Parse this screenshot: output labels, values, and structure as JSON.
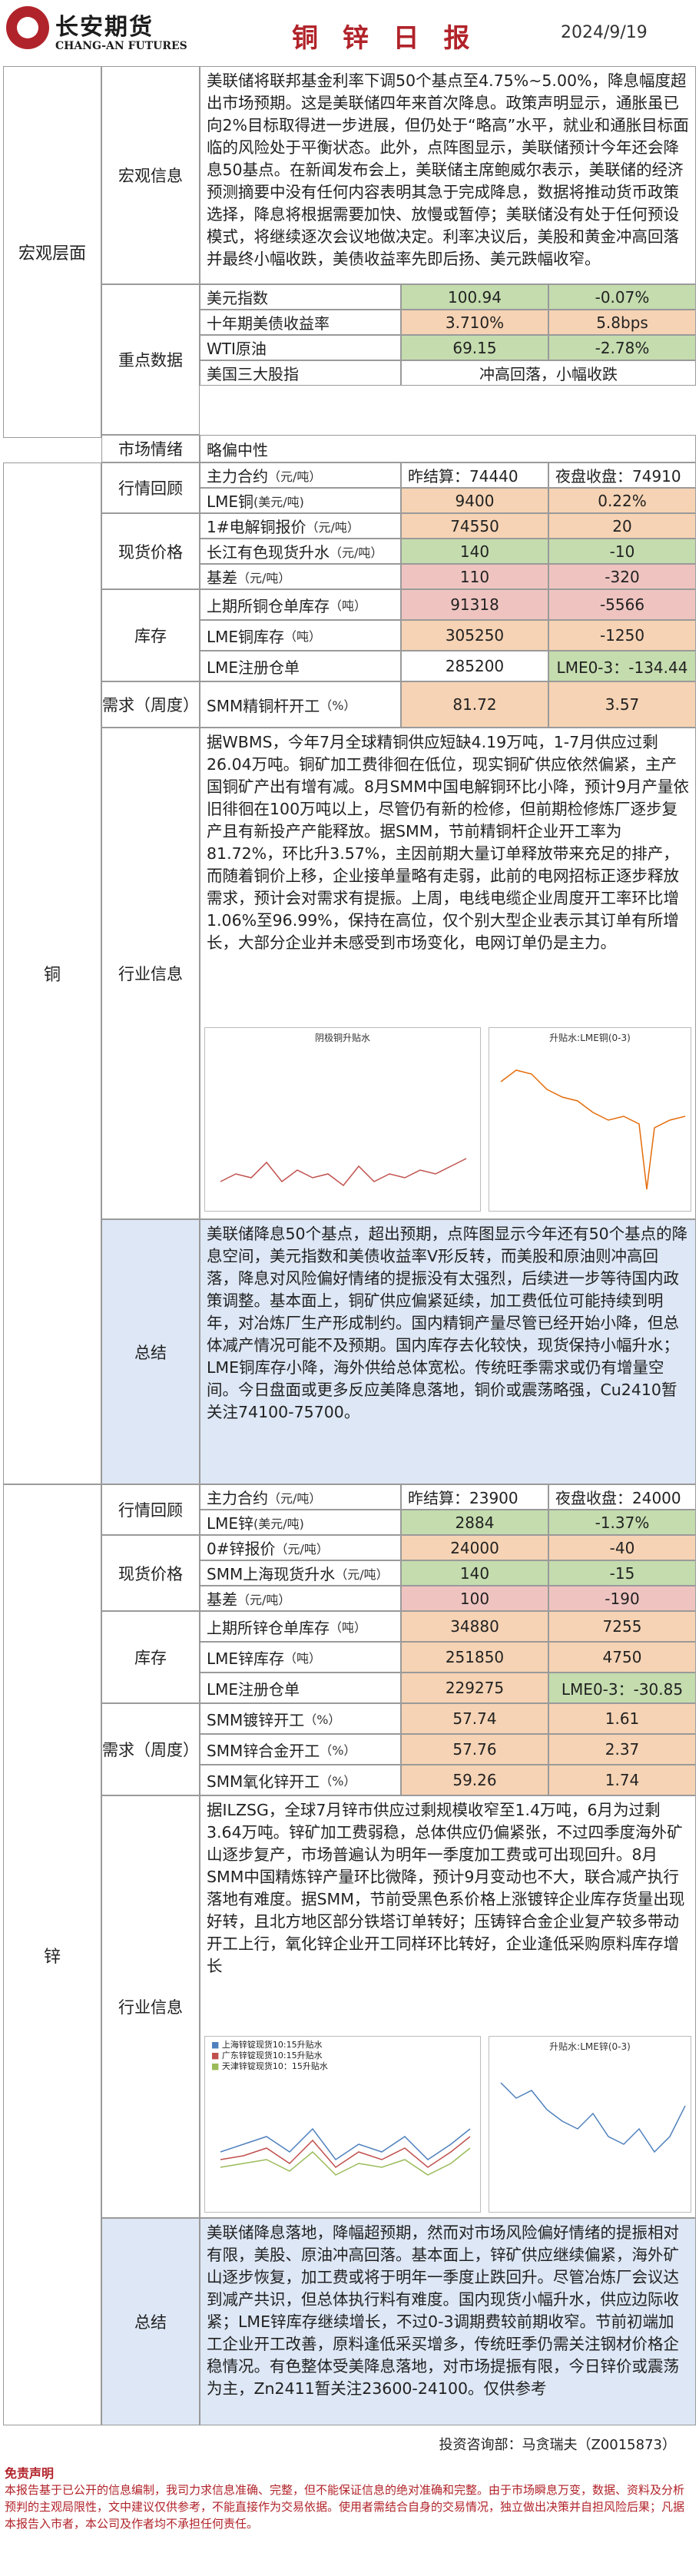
{
  "header": {
    "logo_cn": "长安期货",
    "logo_en": "CHANG-AN FUTURES",
    "title": "铜 锌 日 报",
    "date": "2024/9/19",
    "brand_color": "#b1232a"
  },
  "macro": {
    "section": "宏观层面",
    "info_label": "宏观信息",
    "info_text": "美联储将联邦基金利率下调50个基点至4.75%~5.00%，降息幅度超出市场预期。这是美联储四年来首次降息。政策声明显示，通胀虽已向2%目标取得进一步进展，但仍处于“略高”水平，就业和通胀目标面临的风险处于平衡状态。此外，点阵图显示，美联储预计今年还会降息50基点。在新闻发布会上，美联储主席鲍威尔表示，美联储的经济预测摘要中没有任何内容表明其急于完成降息，数据将推动货币政策选择，降息将根据需要加快、放慢或暂停；美联储没有处于任何预设模式，将继续逐次会议地做决定。利率决议后，美股和黄金冲高回落并最终小幅收跌，美债收益率先即后扬、美元跌幅收窄。",
    "key_label": "重点数据",
    "key_rows": [
      {
        "name": "美元指数",
        "v1": "100.94",
        "v2": "-0.07%"
      },
      {
        "name": "十年期美债收益率",
        "v1": "3.710%",
        "v2": "5.8bps"
      },
      {
        "name": "WTI原油",
        "v1": "69.15",
        "v2": "-2.78%"
      },
      {
        "name": "美国三大股指",
        "v1": "冲高回落，小幅收跌"
      }
    ],
    "mood_label": "市场情绪",
    "mood_value": "略偏中性"
  },
  "copper": {
    "section": "铜",
    "quote_label": "行情回顾",
    "quote_rows": [
      {
        "name": "主力合约",
        "unit": "（元/吨）",
        "v1": "昨结算：74440",
        "v2": "夜盘收盘：74910"
      },
      {
        "name": "LME铜",
        "unit": "(美元/吨)",
        "v1": "9400",
        "v2": "0.22%"
      }
    ],
    "spot_label": "现货价格",
    "spot_rows": [
      {
        "name": "1#电解铜报价",
        "unit": "（元/吨）",
        "v1": "74550",
        "v2": "20"
      },
      {
        "name": "长江有色现货升水",
        "unit": "（元/吨）",
        "v1": "140",
        "v2": "-10"
      },
      {
        "name": "基差",
        "unit": "（元/吨）",
        "v1": "110",
        "v2": "-320"
      }
    ],
    "stock_label": "库存",
    "stock_rows": [
      {
        "name": "上期所铜仓单库存",
        "unit": "（吨）",
        "v1": "91318",
        "v2": "-5566"
      },
      {
        "name": "LME铜库存",
        "unit": "（吨）",
        "v1": "305250",
        "v2": "-1250"
      },
      {
        "name": "LME注册仓单",
        "unit": "",
        "v1": "285200",
        "v2": "LME0-3：-134.44"
      }
    ],
    "demand_label": "需求（周度）",
    "demand_rows": [
      {
        "name": "SMM精铜杆开工",
        "unit": "（%）",
        "v1": "81.72",
        "v2": "3.57"
      }
    ],
    "industry_label": "行业信息",
    "industry_text": "据WBMS，今年7月全球精铜供应短缺4.19万吨，1-7月供应过剩26.04万吨。铜矿加工费徘徊在低位，现实铜矿供应依然偏紧，主产国铜矿产出有增有减。8月SMM中国电解铜环比小降，预计9月产量依旧徘徊在100万吨以上，尽管仍有新的检修，但前期检修炼厂逐步复产且有新投产产能释放。据SMM，节前精铜杆企业开工率为81.72%，环比升3.57%，主因前期大量订单释放带来充足的排产，而随着铜价上移，企业接单量略有走弱，此前的电网招标正逐步释放需求，预计会对需求有提振。上周，电线电缆企业周度开工率环比增1.06%至96.99%，保持在高位，仅个别大型企业表示其订单有所增长，大部分企业并未感受到市场变化，电网订单仍是主力。",
    "chart1_title": "阴极铜升贴水",
    "chart2_title": "升贴水:LME铜(0-3)",
    "summary_label": "总结",
    "summary_text": "美联储降息50个基点，超出预期，点阵图显示今年还有50个基点的降息空间，美元指数和美债收益率V形反转，而美股和原油则冲高回落，降息对风险偏好情绪的提振没有太强烈，后续进一步等待国内政策调整。基本面上，铜矿供应偏紧延续，加工费低位可能持续到明年，对冶炼厂生产形成制约。国内精铜产量尽管已经开始小降，但总体减产情况可能不及预期。国内库存去化较快，现货保持小幅升水；LME铜库存小降，海外供给总体宽松。传统旺季需求或仍有增量空间。今日盘面或更多反应美降息落地，铜价或震荡略强，Cu2410暂关注74100-75700。"
  },
  "zinc": {
    "section": "锌",
    "quote_label": "行情回顾",
    "quote_rows": [
      {
        "name": "主力合约",
        "unit": "（元/吨）",
        "v1": "昨结算：23900",
        "v2": "夜盘收盘：24000"
      },
      {
        "name": "LME锌",
        "unit": "(美元/吨)",
        "v1": "2884",
        "v2": "-1.37%"
      }
    ],
    "spot_label": "现货价格",
    "spot_rows": [
      {
        "name": "0#锌报价",
        "unit": "（元/吨）",
        "v1": "24000",
        "v2": "-40"
      },
      {
        "name": "SMM上海现货升水",
        "unit": "（元/吨）",
        "v1": "140",
        "v2": "-15"
      },
      {
        "name": "基差",
        "unit": "（元/吨）",
        "v1": "100",
        "v2": "-190"
      }
    ],
    "stock_label": "库存",
    "stock_rows": [
      {
        "name": "上期所锌仓单库存",
        "unit": "（吨）",
        "v1": "34880",
        "v2": "7255"
      },
      {
        "name": "LME锌库存",
        "unit": "（吨）",
        "v1": "251850",
        "v2": "4750"
      },
      {
        "name": "LME注册仓单",
        "unit": "",
        "v1": "229275",
        "v2": "LME0-3：-30.85"
      }
    ],
    "demand_label": "需求（周度）",
    "demand_rows": [
      {
        "name": "SMM镀锌开工",
        "unit": "（%）",
        "v1": "57.74",
        "v2": "1.61"
      },
      {
        "name": "SMM锌合金开工",
        "unit": "（%）",
        "v1": "57.76",
        "v2": "2.37"
      },
      {
        "name": "SMM氧化锌开工",
        "unit": "（%）",
        "v1": "59.26",
        "v2": "1.74"
      }
    ],
    "industry_label": "行业信息",
    "industry_text": "据ILZSG，全球7月锌市供应过剩规模收窄至1.4万吨，6月为过剩3.64万吨。锌矿加工费弱稳，总体供应仍偏紧张，不过四季度海外矿山逐步复产，市场普遍认为明年一季度加工费或可出现回升。8月SMM中国精炼锌产量环比微降，预计9月变动也不大，联合减产执行落地有难度。据SMM，节前受黑色系价格上涨镀锌企业库存货量出现好转，且北方地区部分铁塔订单转好；压铸锌合金企业复产较多带动开工上行，氧化锌企业开工同样环比转好，企业逢低采购原料库存增长",
    "chart1_legend": [
      "上海锌锭现货10:15升贴水",
      "广东锌锭现货10:15升贴水",
      "天津锌锭现货10：15升贴水"
    ],
    "chart2_title": "升贴水:LME锌(0-3)",
    "summary_label": "总结",
    "summary_text": "美联储降息落地，降幅超预期，然而对市场风险偏好情绪的提振相对有限，美股、原油冲高回落。基本面上，锌矿供应继续偏紧，海外矿山逐步恢复，加工费或将于明年一季度止跌回升。尽管冶炼厂会议达到减产共识，但总体执行料有难度。国内现货小幅升水，供应边际收紧；LME锌库存继续增长，不过0-3调期费较前期收窄。节前初端加工企业开工改善，原料逢低采买增多，传统旺季仍需关注钢材价格企稳情况。有色整体受美降息落地，对市场提振有限，今日锌价或震荡为主，Zn2411暂关注23600-24100。仅供参考"
  },
  "footer": {
    "consultant": "投资咨询部：马贪瑞夫（Z0015873）",
    "disclaimer_title": "免责声明",
    "disclaimer_text": "本报告基于已公开的信息编制，我司力求信息准确、完整，但不能保证信息的绝对准确和完整。由于市场瞬息万变，数据、资料及分析预判的主观局限性，文中建议仅供参考，不能直接作为交易依据。使用者需结合自身的交易情况，独立做出决策并自担风险后果；凡据本报告入市者，本公司及作者均不承担任何责任。"
  }
}
